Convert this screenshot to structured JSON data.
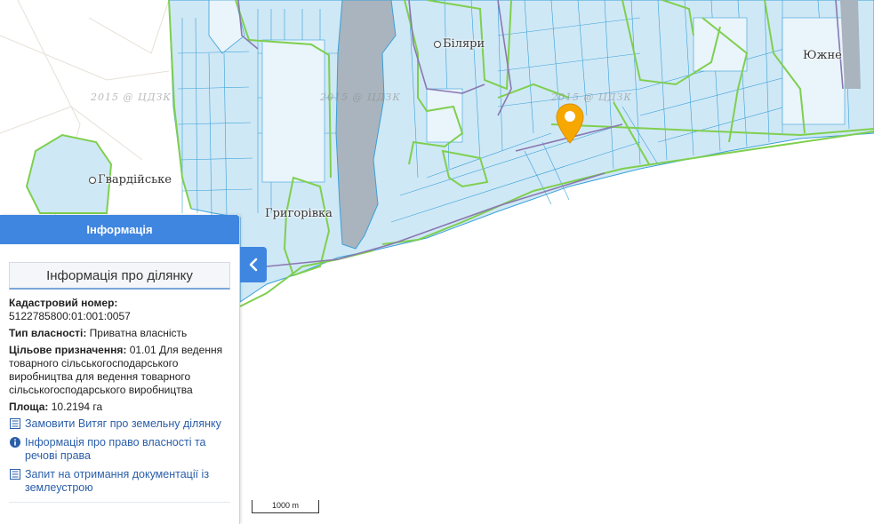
{
  "map": {
    "places": [
      {
        "name": "Гвардійське"
      },
      {
        "name": "Григорівка"
      },
      {
        "name": "Біляри"
      },
      {
        "name": "Южне"
      }
    ],
    "watermark": "2015 @ ЦДЗК",
    "scale_label": "1000 m",
    "colors": {
      "parcel_fill": "#cfe8f6",
      "parcel_stroke": "#3aa0d8",
      "boundary_green": "#7fcf4f",
      "boundary_purple": "#8a78b0",
      "water": "#a9b4be",
      "marker": "#f7a800"
    },
    "marker_icon": "map-pin-icon"
  },
  "panel": {
    "header": "Інформація",
    "title": "Інформація про ділянку",
    "cadastral_label": "Кадастровий номер:",
    "cadastral_value": "5122785800:01:001:0057",
    "ownership_label": "Тип власності:",
    "ownership_value": "Приватна власність",
    "purpose_label": "Цільове призначення:",
    "purpose_value": "01.01 Для ведення товарного сільськогосподарського виробництва для ведення товарного сільськогосподарського виробництва",
    "area_label": "Площа:",
    "area_value": "10.2194 га",
    "links": [
      {
        "text": "Замовити Витяг про земельну ділянку",
        "icon": "document-list-icon"
      },
      {
        "text": "Інформація про право власності та речові права",
        "icon": "info-circle-icon"
      },
      {
        "text": "Запит на отримання документації із землеустрою",
        "icon": "document-list-icon"
      }
    ],
    "collapse_icon": "chevron-left-icon"
  }
}
